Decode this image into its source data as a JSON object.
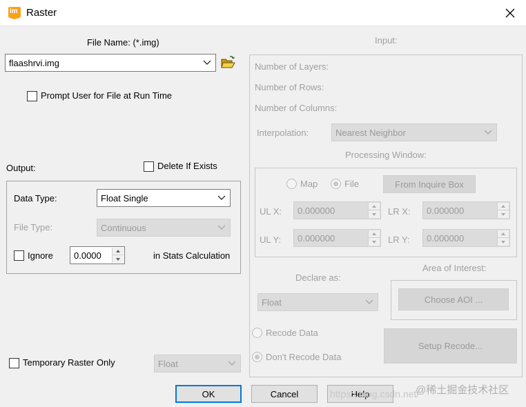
{
  "window": {
    "title": "Raster",
    "app_icon_text": "im",
    "close_icon": "close-icon"
  },
  "file": {
    "label": "File Name: (*.img)",
    "value": "flaashrvi.img",
    "prompt_label": "Prompt User for File at Run Time",
    "prompt_checked": false
  },
  "output": {
    "label": "Output:",
    "delete_label": "Delete If Exists",
    "delete_checked": false,
    "data_type_label": "Data Type:",
    "data_type_value": "Float Single",
    "file_type_label": "File Type:",
    "file_type_value": "Continuous",
    "ignore_label": "Ignore",
    "ignore_checked": false,
    "ignore_value": "0.0000",
    "stats_label": "in Stats Calculation"
  },
  "temporary": {
    "label": "Temporary Raster Only",
    "checked": false,
    "value": "Float"
  },
  "input": {
    "label": "Input:",
    "layers_label": "Number of Layers:",
    "rows_label": "Number of Rows:",
    "columns_label": "Number of Columns:",
    "interpolation_label": "Interpolation:",
    "interpolation_value": "Nearest Neighbor",
    "processing_window_label": "Processing Window:",
    "map_label": "Map",
    "file_label": "File",
    "file_selected": true,
    "inquire_button": "From Inquire Box",
    "ulx_label": "UL X:",
    "ulx_value": "0.000000",
    "uly_label": "UL Y:",
    "uly_value": "0.000000",
    "lrx_label": "LR X:",
    "lrx_value": "0.000000",
    "lry_label": "LR Y:",
    "lry_value": "0.000000",
    "declare_label": "Declare as:",
    "declare_value": "Float",
    "aoi_label": "Area of Interest:",
    "aoi_button": "Choose AOI ...",
    "recode_label": "Recode Data",
    "dont_recode_label": "Don't Recode Data",
    "dont_recode_selected": true,
    "setup_recode_button": "Setup Recode..."
  },
  "buttons": {
    "ok": "OK",
    "cancel": "Cancel",
    "help": "Help"
  },
  "watermark": {
    "url": "https://blog.csdn.net/",
    "brand": "@稀土掘金技术社区"
  },
  "colors": {
    "accent": "#0078d7",
    "app_icon": "#f7a21b"
  }
}
